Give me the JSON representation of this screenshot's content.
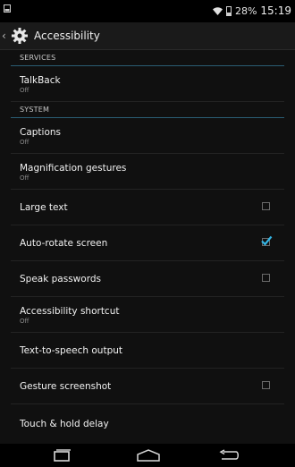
{
  "status_bar": {
    "battery_percent_text": "28%",
    "battery_level": 0.28,
    "time": "15:19",
    "icons": [
      "notification-icon",
      "wifi-icon",
      "battery-icon"
    ]
  },
  "action_bar": {
    "title": "Accessibility",
    "icons": [
      "up-chevron-icon",
      "gear-icon"
    ]
  },
  "sections": {
    "services": "SERVICES",
    "system": "SYSTEM"
  },
  "items": {
    "talkback": {
      "title": "TalkBack",
      "summary": "Off"
    },
    "captions": {
      "title": "Captions",
      "summary": "Off"
    },
    "magnification": {
      "title": "Magnification gestures",
      "summary": "Off"
    },
    "large_text": {
      "title": "Large text",
      "checked": false
    },
    "auto_rotate": {
      "title": "Auto-rotate screen",
      "checked": true
    },
    "speak_passwords": {
      "title": "Speak passwords",
      "checked": false
    },
    "accessibility_shortcut": {
      "title": "Accessibility shortcut",
      "summary": "Off"
    },
    "tts_output": {
      "title": "Text-to-speech output"
    },
    "gesture_screenshot": {
      "title": "Gesture screenshot",
      "checked": false
    },
    "touch_hold_delay": {
      "title": "Touch & hold delay"
    }
  },
  "colors": {
    "accent": "#33b5e5",
    "section_divider": "#2a5d74",
    "background": "#101010"
  },
  "nav_bar": {
    "icons": [
      "recent-apps-icon",
      "home-icon",
      "back-icon"
    ]
  }
}
